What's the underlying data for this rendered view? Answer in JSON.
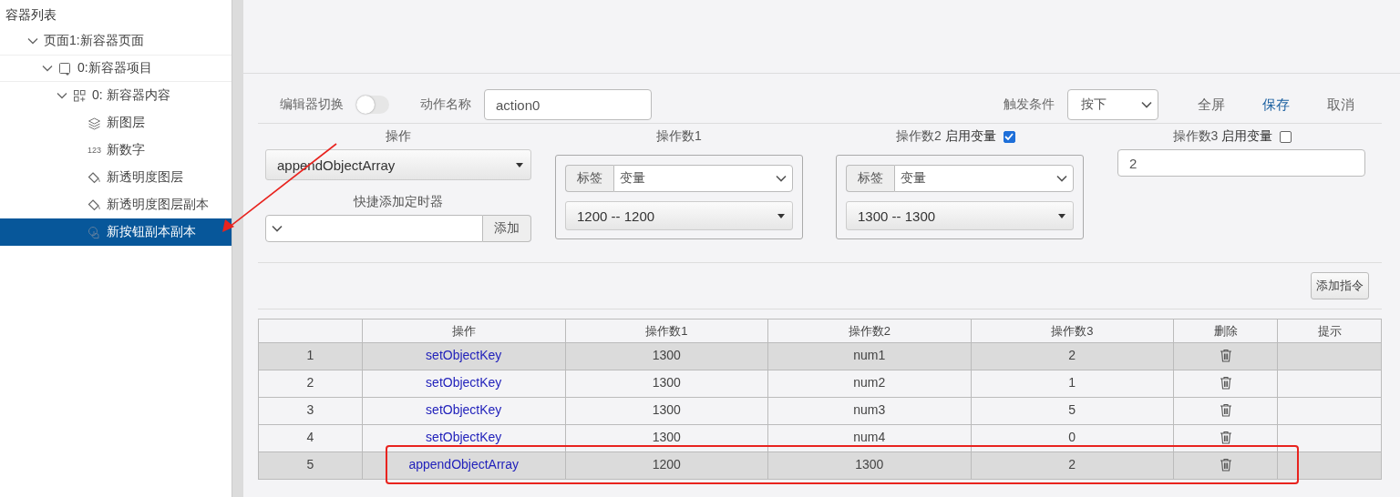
{
  "sidebar": {
    "title": "容器列表",
    "tree": [
      {
        "label": "页面1:新容器页面",
        "expanded": true,
        "selected": false,
        "pointed": false,
        "children": [
          {
            "label": "0:新容器项目",
            "kind": "container",
            "expanded": true,
            "selected": false,
            "pointed": false,
            "children": [
              {
                "label": "0: 新容器内容",
                "kind": "grid",
                "expanded": true,
                "selected": false,
                "pointed": false,
                "children": [
                  {
                    "label": "新图层",
                    "kind": "layers",
                    "selected": false,
                    "pointed": false
                  },
                  {
                    "label": "新数字",
                    "kind": "number",
                    "icon_text": "123",
                    "selected": false,
                    "pointed": false
                  },
                  {
                    "label": "新透明度图层",
                    "kind": "bucket",
                    "selected": false,
                    "pointed": false
                  },
                  {
                    "label": "新透明度图层副本",
                    "kind": "bucket",
                    "selected": false,
                    "pointed": false
                  },
                  {
                    "label": "新按钮副本副本",
                    "kind": "hand",
                    "selected": true,
                    "pointed": true
                  }
                ]
              }
            ]
          }
        ]
      }
    ]
  },
  "editor": {
    "toggle_label": "编辑器切换",
    "toggle_on": false,
    "name_label": "动作名称",
    "name_value": "action0",
    "trigger_label": "触发条件",
    "trigger_value": "按下",
    "actions": [
      {
        "label": "全屏",
        "primary": false
      },
      {
        "label": "保存",
        "primary": true
      },
      {
        "label": "取消",
        "primary": false
      }
    ]
  },
  "operation": {
    "label": "操作",
    "value": "appendObjectArray",
    "timer_label": "快捷添加定时器",
    "add_button": "添加"
  },
  "operands": [
    {
      "label": "操作数1",
      "kind": "variable",
      "addon": "标签",
      "type_value": "变量",
      "value": "1200 -- 1200"
    },
    {
      "label": "操作数2",
      "kind": "variable",
      "toggle_label": "启用变量",
      "enabled": true,
      "addon": "标签",
      "type_value": "变量",
      "value": "1300 -- 1300"
    },
    {
      "label": "操作数3",
      "kind": "plain",
      "toggle_label": "启用变量",
      "enabled": false,
      "value": "2"
    }
  ],
  "add_command_button": "添加指令",
  "table": {
    "columns": [
      "操作",
      "操作数1",
      "操作数2",
      "操作数3",
      "删除",
      "提示"
    ],
    "rows": [
      {
        "index": "1",
        "op": "setObjectKey",
        "a1": "1300",
        "a2": "num1",
        "a3": "2",
        "shaded": true,
        "highlighted": false
      },
      {
        "index": "2",
        "op": "setObjectKey",
        "a1": "1300",
        "a2": "num2",
        "a3": "1",
        "shaded": false,
        "highlighted": false
      },
      {
        "index": "3",
        "op": "setObjectKey",
        "a1": "1300",
        "a2": "num3",
        "a3": "5",
        "shaded": false,
        "highlighted": false
      },
      {
        "index": "4",
        "op": "setObjectKey",
        "a1": "1300",
        "a2": "num4",
        "a3": "0",
        "shaded": false,
        "highlighted": false
      },
      {
        "index": "5",
        "op": "appendObjectArray",
        "a1": "1200",
        "a2": "1300",
        "a3": "2",
        "shaded": true,
        "highlighted": true
      }
    ]
  }
}
